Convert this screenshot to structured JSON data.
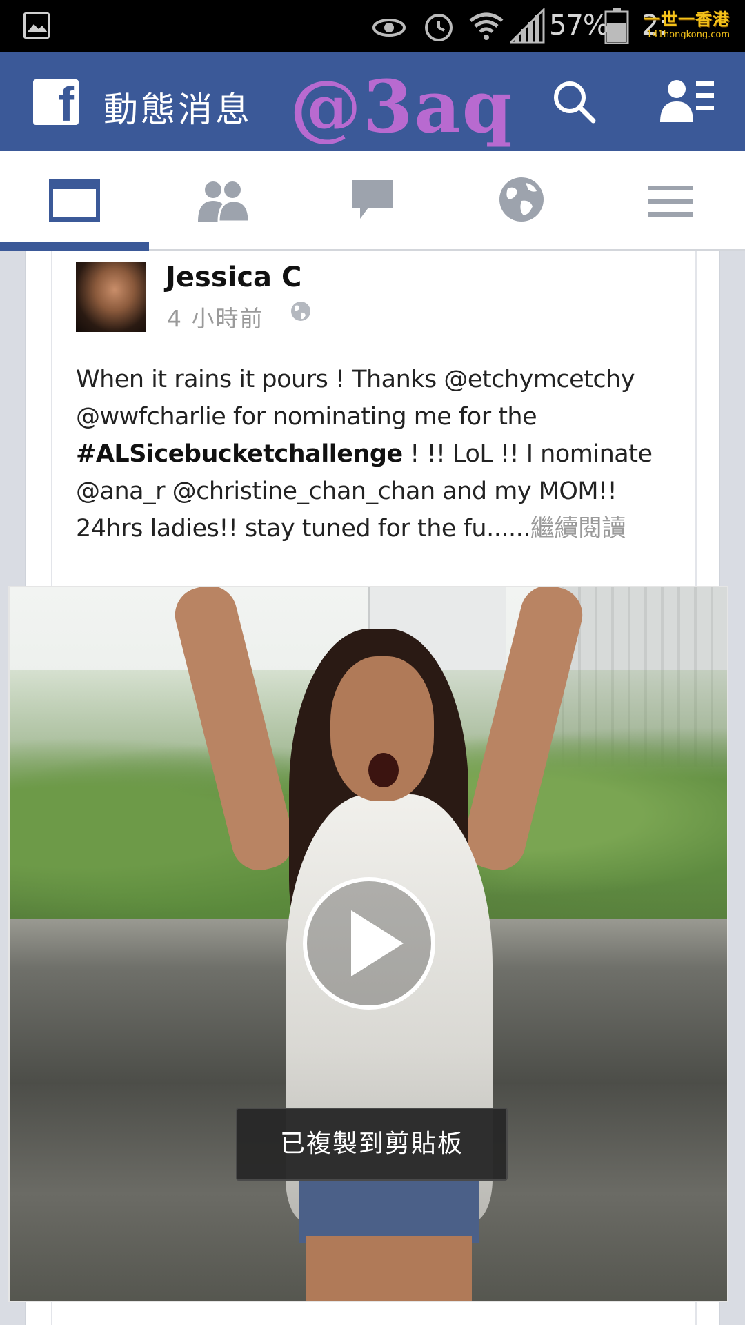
{
  "status_bar": {
    "battery": "57%",
    "time": "2:",
    "watermark_title": "一世一香港",
    "watermark_sub": "141hongkong.com"
  },
  "header": {
    "title": "動態消息",
    "overlay_tag": "@3aq",
    "brand_color": "#3b5998"
  },
  "tabs": [
    {
      "name": "news-feed",
      "icon": "news-feed-icon",
      "active": true
    },
    {
      "name": "friend-requests",
      "icon": "friends-icon",
      "active": false
    },
    {
      "name": "messages",
      "icon": "chat-icon",
      "active": false
    },
    {
      "name": "notifications",
      "icon": "globe-icon",
      "active": false
    },
    {
      "name": "more",
      "icon": "menu-icon",
      "active": false
    }
  ],
  "post": {
    "author": "Jessica C",
    "timestamp": "4 小時前",
    "privacy": "globe-icon",
    "text_line1": "When it rains it pours ! Thanks @etchymcetchy",
    "text_line2": "@wwfcharlie for nominating me for the",
    "hashtag": "#ALSicebucketchallenge",
    "text_line3_rest": " !  !! LoL !! I nominate",
    "text_line4": "@ana_r @christine_chan_chan and my MOM!!",
    "text_line5": "24hrs ladies!!  stay tuned for the fu......",
    "see_more": "繼續閱讀"
  },
  "toast": {
    "message": "已複製到剪貼板"
  }
}
